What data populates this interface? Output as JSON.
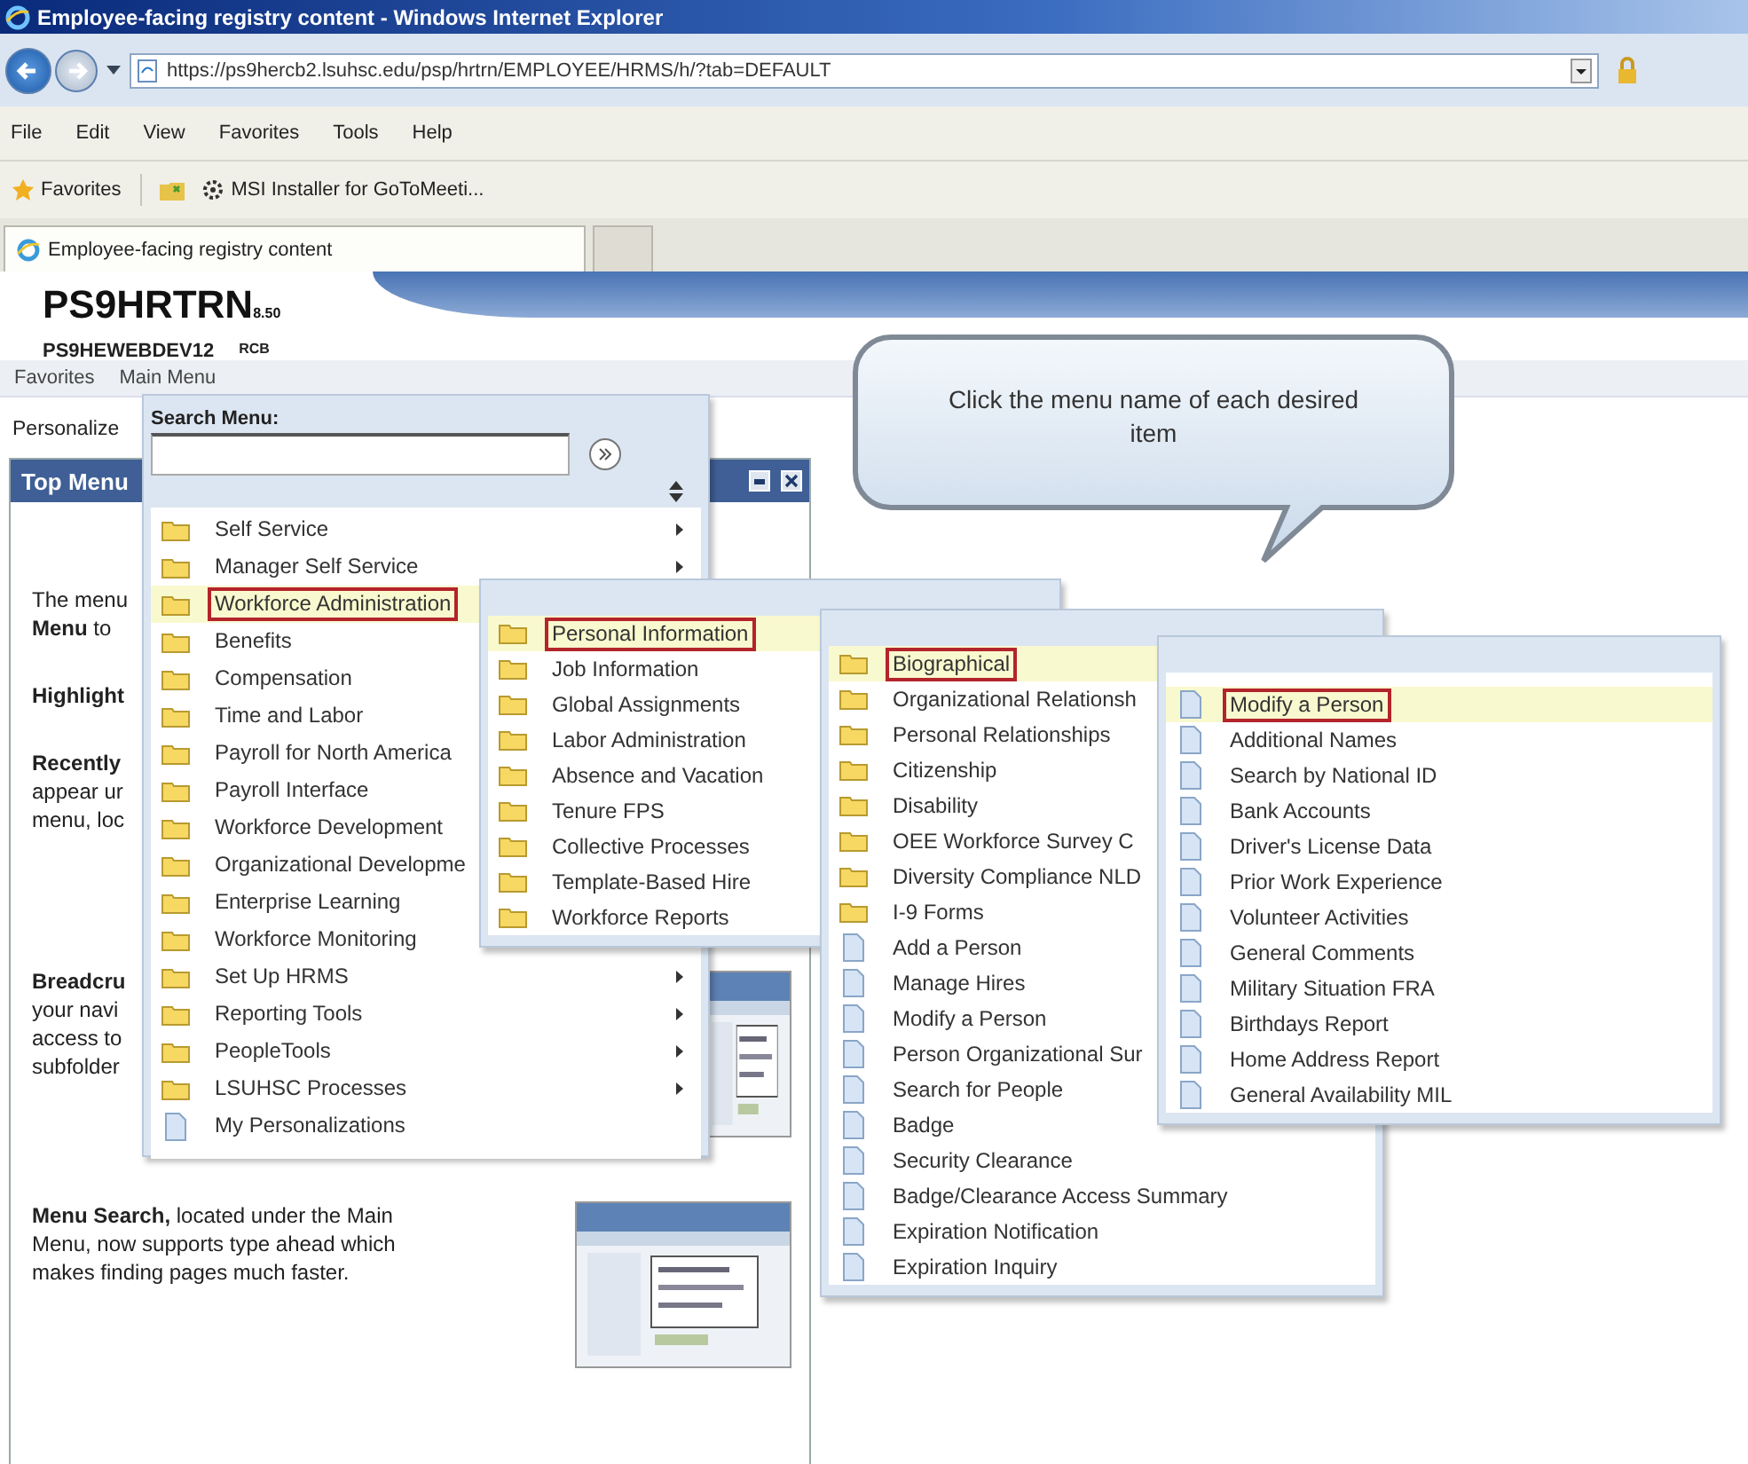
{
  "window": {
    "title": "Employee-facing registry content - Windows Internet Explorer"
  },
  "address_bar": {
    "url": "https://ps9hercb2.lsuhsc.edu/psp/hrtrn/EMPLOYEE/HRMS/h/?tab=DEFAULT"
  },
  "menu_bar": [
    "File",
    "Edit",
    "View",
    "Favorites",
    "Tools",
    "Help"
  ],
  "favorites_bar": {
    "label": "Favorites",
    "links": [
      "MSI Installer for GoToMeeti..."
    ]
  },
  "tabs": [
    {
      "label": "Employee-facing registry content",
      "selected": true
    }
  ],
  "page": {
    "app_title": "PS9HRTRN",
    "version": "8.50",
    "server": "PS9HEWEBDEV12",
    "user": "RCB",
    "nav": [
      "Favorites",
      "Main Menu"
    ],
    "personalize": "Personalize",
    "pagelet": {
      "title": "Top Menu",
      "blocks": [
        {
          "lines": [
            {
              "text": "The menu",
              "kind": "line"
            },
            {
              "text": "**Menu** to",
              "kind": "line"
            }
          ]
        },
        {
          "lines": [
            {
              "text": "Highlight",
              "kind": "heading"
            }
          ]
        },
        {
          "lines": [
            {
              "text": "Recently",
              "kind": "heading"
            },
            {
              "text": "appear ur",
              "kind": "line"
            },
            {
              "text": "menu, loc",
              "kind": "line"
            }
          ]
        },
        {
          "lines": [
            {
              "text": "Breadcru",
              "kind": "heading"
            },
            {
              "text": "your navi",
              "kind": "line"
            },
            {
              "text": "access to",
              "kind": "line"
            },
            {
              "text": "subfolder",
              "kind": "line"
            }
          ],
          "picture": {
            "kind": "picture"
          }
        },
        {
          "lines": [
            {
              "text": "**Menu Search,** located under the Main Menu, now supports type ahead which makes finding pages much faster.",
              "kind": "line"
            }
          ],
          "picture": {
            "kind": "picture"
          }
        }
      ]
    }
  },
  "main_menu": {
    "search_label": "Search Menu:",
    "items": [
      {
        "label": "Self Service",
        "kind": "folder",
        "arrow": true,
        "selected": false
      },
      {
        "label": "Manager Self Service",
        "kind": "folder",
        "arrow": true,
        "selected": false
      },
      {
        "label": "Workforce Administration",
        "kind": "folder",
        "arrow": false,
        "selected": true
      },
      {
        "label": "Benefits",
        "kind": "folder",
        "arrow": false,
        "selected": false
      },
      {
        "label": "Compensation",
        "kind": "folder",
        "arrow": false,
        "selected": false
      },
      {
        "label": "Time and Labor",
        "kind": "folder",
        "arrow": false,
        "selected": false
      },
      {
        "label": "Payroll for North America",
        "kind": "folder",
        "arrow": false,
        "selected": false
      },
      {
        "label": "Payroll Interface",
        "kind": "folder",
        "arrow": false,
        "selected": false
      },
      {
        "label": "Workforce Development",
        "kind": "folder",
        "arrow": false,
        "selected": false
      },
      {
        "label": "Organizational Developme",
        "kind": "folder",
        "arrow": false,
        "selected": false
      },
      {
        "label": "Enterprise Learning",
        "kind": "folder",
        "arrow": false,
        "selected": false
      },
      {
        "label": "Workforce Monitoring",
        "kind": "folder",
        "arrow": false,
        "selected": false
      },
      {
        "label": "Set Up HRMS",
        "kind": "folder",
        "arrow": true,
        "selected": false
      },
      {
        "label": "Reporting Tools",
        "kind": "folder",
        "arrow": true,
        "selected": false
      },
      {
        "label": "PeopleTools",
        "kind": "folder",
        "arrow": true,
        "selected": false
      },
      {
        "label": "LSUHSC Processes",
        "kind": "folder",
        "arrow": true,
        "selected": false
      },
      {
        "label": "My Personalizations",
        "kind": "page",
        "arrow": false,
        "selected": false
      }
    ]
  },
  "submenus": [
    {
      "items": [
        {
          "label": "Personal Information",
          "kind": "folder",
          "selected": true
        },
        {
          "label": "Job Information",
          "kind": "folder",
          "selected": false
        },
        {
          "label": "Global Assignments",
          "kind": "folder",
          "selected": false
        },
        {
          "label": "Labor Administration",
          "kind": "folder",
          "selected": false
        },
        {
          "label": "Absence and Vacation",
          "kind": "folder",
          "selected": false
        },
        {
          "label": "Tenure FPS",
          "kind": "folder",
          "selected": false
        },
        {
          "label": "Collective Processes",
          "kind": "folder",
          "selected": false
        },
        {
          "label": "Template-Based Hire",
          "kind": "folder",
          "selected": false
        },
        {
          "label": "Workforce Reports",
          "kind": "folder",
          "selected": false
        }
      ]
    },
    {
      "items": [
        {
          "label": "Biographical",
          "kind": "folder",
          "selected": true
        },
        {
          "label": "Organizational Relationsh",
          "kind": "folder",
          "selected": false
        },
        {
          "label": "Personal Relationships",
          "kind": "folder",
          "selected": false
        },
        {
          "label": "Citizenship",
          "kind": "folder",
          "selected": false
        },
        {
          "label": "Disability",
          "kind": "folder",
          "selected": false
        },
        {
          "label": "OEE Workforce Survey C",
          "kind": "folder",
          "selected": false
        },
        {
          "label": "Diversity Compliance NLD",
          "kind": "folder",
          "selected": false
        },
        {
          "label": "I-9 Forms",
          "kind": "folder",
          "selected": false
        },
        {
          "label": "Add a Person",
          "kind": "page",
          "selected": false
        },
        {
          "label": "Manage Hires",
          "kind": "page",
          "selected": false
        },
        {
          "label": "Modify a Person",
          "kind": "page",
          "selected": false
        },
        {
          "label": "Person Organizational Sur",
          "kind": "page",
          "selected": false
        },
        {
          "label": "Search for People",
          "kind": "page",
          "selected": false
        },
        {
          "label": "Badge",
          "kind": "page",
          "selected": false
        },
        {
          "label": "Security Clearance",
          "kind": "page",
          "selected": false
        },
        {
          "label": "Badge/Clearance Access Summary",
          "kind": "page",
          "selected": false
        },
        {
          "label": "Expiration Notification",
          "kind": "page",
          "selected": false
        },
        {
          "label": "Expiration Inquiry",
          "kind": "page",
          "selected": false
        }
      ]
    },
    {
      "items": [
        {
          "label": "Modify a Person",
          "kind": "page",
          "selected": true
        },
        {
          "label": "Additional Names",
          "kind": "page",
          "selected": false
        },
        {
          "label": "Search by National ID",
          "kind": "page",
          "selected": false
        },
        {
          "label": "Bank Accounts",
          "kind": "page",
          "selected": false
        },
        {
          "label": "Driver's License Data",
          "kind": "page",
          "selected": false
        },
        {
          "label": "Prior Work Experience",
          "kind": "page",
          "selected": false
        },
        {
          "label": "Volunteer Activities",
          "kind": "page",
          "selected": false
        },
        {
          "label": "General Comments",
          "kind": "page",
          "selected": false
        },
        {
          "label": "Military Situation FRA",
          "kind": "page",
          "selected": false
        },
        {
          "label": "Birthdays Report",
          "kind": "page",
          "selected": false
        },
        {
          "label": "Home Address Report",
          "kind": "page",
          "selected": false
        },
        {
          "label": "General Availability MIL",
          "kind": "page",
          "selected": false
        }
      ]
    }
  ],
  "callout": {
    "text": "Click the menu name of each desired item"
  }
}
